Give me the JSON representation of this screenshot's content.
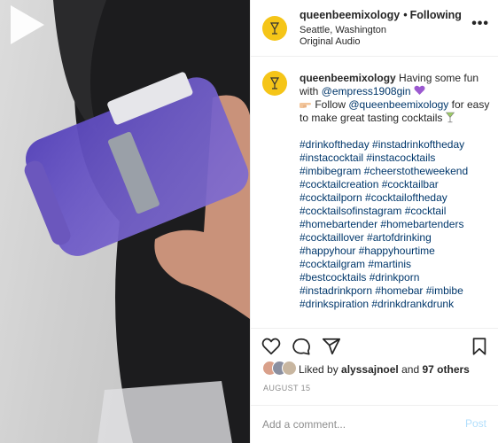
{
  "post": {
    "username": "queenbeemixology",
    "separator": "•",
    "follow_status": "Following",
    "location": "Seattle, Washington",
    "audio": "Original Audio",
    "more_label": "•••"
  },
  "caption": {
    "username": "queenbeemixology",
    "text_1": "Having some fun with",
    "mention_1": "@empress1908gin",
    "text_2": "Follow",
    "mention_2": "@queenbeemixology",
    "text_3": "for easy to make great tasting cocktails",
    "hashtag_lines": [
      "#drinkoftheday #instadrinkoftheday",
      "#instacocktail #instacocktails",
      "#imbibegram #cheerstotheweekend",
      "#cocktailcreation #cocktailbar",
      "#cocktailporn #cocktailoftheday",
      "#cocktailsofinstagram #cocktail",
      "#homebartender #homebartenders",
      "#cocktaillover #artofdrinking",
      "#happyhour #happyhourtime",
      "#cocktailgram #martinis",
      "#bestcocktails #drinkporn",
      "#instadrinkporn #homebar #imbibe",
      "#drinkspiration #drinkdrankdrunk"
    ]
  },
  "actions": {
    "icons": [
      "heart-icon",
      "comment-icon",
      "share-icon",
      "bookmark-icon"
    ]
  },
  "likes": {
    "prefix": "Liked by",
    "user": "alyssajnoel",
    "conjunction": "and",
    "others": "97 others"
  },
  "date": "AUGUST 15",
  "comment": {
    "placeholder": "Add a comment...",
    "post_label": "Post"
  },
  "colors": {
    "link": "#00376b",
    "post_disabled": "#b2dffc",
    "avatar_bg": "#f5c518",
    "muted": "#8e8e8e",
    "liquid": "#5b3fd0"
  }
}
